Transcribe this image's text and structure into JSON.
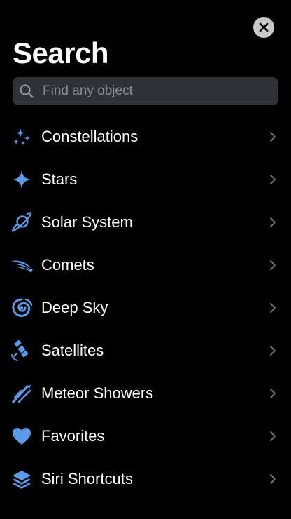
{
  "header": {
    "title": "Search"
  },
  "search": {
    "placeholder": "Find any object"
  },
  "colors": {
    "accent": "#5b9ae6",
    "background": "#000000",
    "search_bg": "#2f3236"
  },
  "items": [
    {
      "label": "Constellations",
      "icon": "constellation-icon"
    },
    {
      "label": "Stars",
      "icon": "star-icon"
    },
    {
      "label": "Solar System",
      "icon": "planet-icon"
    },
    {
      "label": "Comets",
      "icon": "comet-icon"
    },
    {
      "label": "Deep Sky",
      "icon": "galaxy-icon"
    },
    {
      "label": "Satellites",
      "icon": "satellite-icon"
    },
    {
      "label": "Meteor Showers",
      "icon": "meteor-icon"
    },
    {
      "label": "Favorites",
      "icon": "heart-icon"
    },
    {
      "label": "Siri Shortcuts",
      "icon": "layers-icon"
    }
  ]
}
